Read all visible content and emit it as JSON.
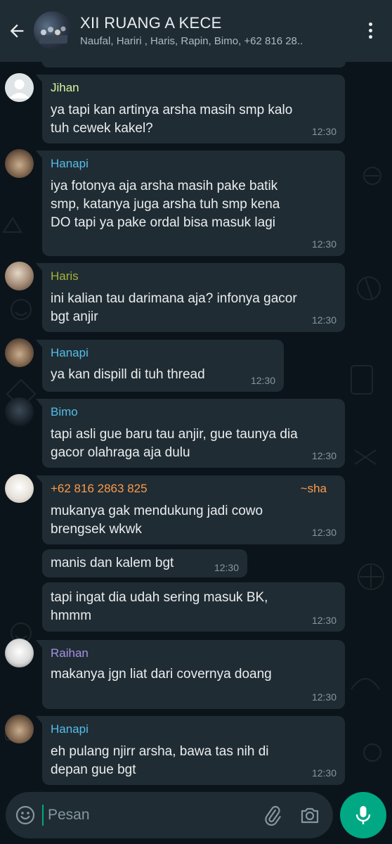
{
  "header": {
    "title": "XII RUANG A KECE",
    "subtitle": "Naufal, Hariri , Haris, Rapin, Bimo, +62 816 28..",
    "icons": {
      "back": "arrow-left-icon",
      "menu": "more-vert-icon"
    }
  },
  "messages": [
    {
      "sender": "Jihan",
      "sender_color": "#d9f5a1",
      "text": "ya tapi kan artinya arsha masih smp kalo\ntuh cewek kakel?",
      "time": "12:30"
    },
    {
      "sender": "Hanapi",
      "sender_color": "#53bdeb",
      "text": "iya fotonya aja arsha masih pake batik\nsmp, katanya juga arsha tuh smp kena\nDO tapi ya pake ordal bisa masuk lagi",
      "time": "12:30"
    },
    {
      "sender": "Haris",
      "sender_color": "#a5b337",
      "text": "ini kalian tau darimana aja? infonya gacor\nbgt anjir",
      "time": "12:30"
    },
    {
      "sender": "Hanapi",
      "sender_color": "#53bdeb",
      "text": "ya kan dispill di tuh thread",
      "time": "12:30"
    },
    {
      "sender": "Bimo",
      "sender_color": "#53bdeb",
      "text": "tapi asli gue baru tau anjir, gue taunya dia\ngacor olahraga aja dulu",
      "time": "12:30"
    },
    {
      "sender": "+62 816 2863 825",
      "sender_color": "#fc9a4c",
      "pushname": "~sha",
      "text": "mukanya gak mendukung jadi cowo\nbrengsek wkwk",
      "time": "12:30"
    },
    {
      "text": "manis dan kalem bgt",
      "time": "12:30"
    },
    {
      "text": "tapi ingat dia udah sering masuk BK,\nhmmm",
      "time": "12:30"
    },
    {
      "sender": "Raihan",
      "sender_color": "#a791e3",
      "text": "makanya jgn liat dari covernya doang",
      "time": "12:30"
    },
    {
      "sender": "Hanapi",
      "sender_color": "#53bdeb",
      "text": "eh pulang njirr arsha, bawa tas nih di\ndepan gue bgt",
      "time": "12:30"
    }
  ],
  "input": {
    "placeholder": "Pesan",
    "icons": {
      "emoji": "emoji-icon",
      "attach": "paperclip-icon",
      "camera": "camera-icon",
      "send": "mic-icon"
    }
  },
  "colors": {
    "background": "#0b141a",
    "header": "#1f2c34",
    "bubble_incoming": "#202c33",
    "accent": "#00a884",
    "timestamp": "#8696a0"
  }
}
